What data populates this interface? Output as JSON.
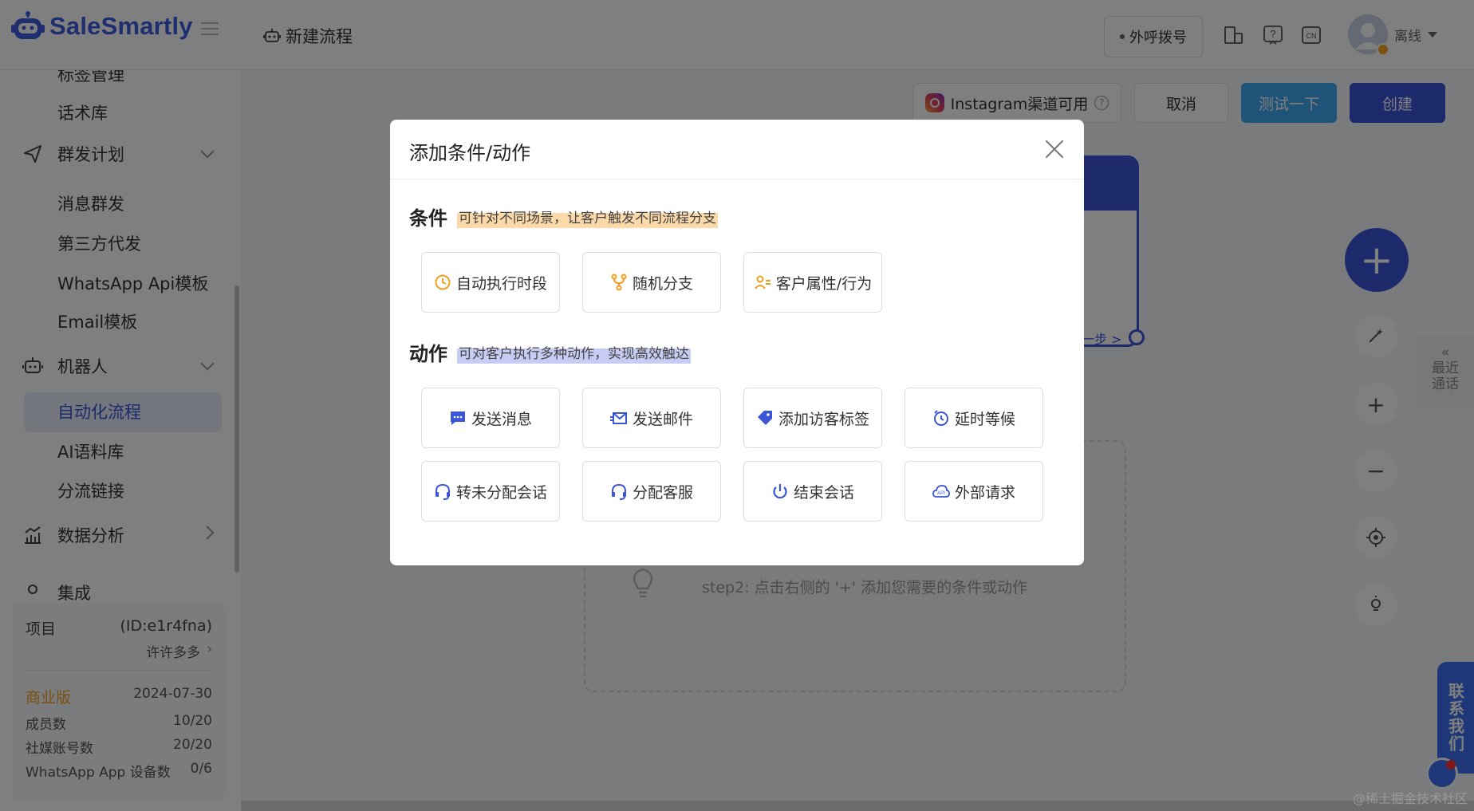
{
  "app": {
    "logo_text": "SaleSmartly",
    "brand_color": "#3b55d8"
  },
  "header": {
    "page_title": "新建流程",
    "dial_label": "外呼拨号",
    "user_status": "离线",
    "icons": [
      "device-icon",
      "help-icon",
      "language-cn-icon"
    ],
    "lang_badge": "CN"
  },
  "sidebar": {
    "cut_top_item": "标签管理",
    "items": [
      {
        "type": "item",
        "label": "话术库"
      },
      {
        "type": "group",
        "label": "群发计划",
        "icon": "send-icon"
      },
      {
        "type": "item",
        "label": "消息群发"
      },
      {
        "type": "item",
        "label": "第三方代发"
      },
      {
        "type": "item",
        "label": "WhatsApp Api模板"
      },
      {
        "type": "item",
        "label": "Email模板"
      },
      {
        "type": "group",
        "label": "机器人",
        "icon": "robot-icon"
      },
      {
        "type": "item",
        "label": "自动化流程",
        "active": true
      },
      {
        "type": "item",
        "label": "AI语料库"
      },
      {
        "type": "item",
        "label": "分流链接"
      },
      {
        "type": "group",
        "label": "数据分析",
        "icon": "chart-icon"
      },
      {
        "type": "group",
        "label": "集成",
        "icon": "integration-icon"
      }
    ],
    "project": {
      "label": "项目",
      "id": "(ID:e1r4fna)",
      "user": "许许多多",
      "plan": "商业版",
      "expiry": "2024-07-30",
      "stats": [
        {
          "label": "成员数",
          "value": "10/20"
        },
        {
          "label": "社媒账号数",
          "value": "20/20"
        },
        {
          "label": "WhatsApp App 设备数",
          "value": "0/6"
        }
      ]
    }
  },
  "toolbar": {
    "instagram_label": "Instagram渠道可用",
    "cancel_label": "取消",
    "test_label": "测试一下",
    "create_label": "创建"
  },
  "canvas": {
    "next_step_label": "一步 >",
    "step2_text": "step2: 点击右侧的 '+' 添加您需要的条件或动作",
    "recent_label": "最近通话",
    "contact_label": "联系我们",
    "watermark": "@稀土掘金技术社区"
  },
  "modal": {
    "title": "添加条件/动作",
    "conditions": {
      "title": "条件",
      "hint": "可针对不同场景，让客户触发不同流程分支",
      "options": [
        {
          "label": "自动执行时段",
          "icon": "clock-icon"
        },
        {
          "label": "随机分支",
          "icon": "branch-icon"
        },
        {
          "label": "客户属性/行为",
          "icon": "user-attribute-icon"
        }
      ]
    },
    "actions": {
      "title": "动作",
      "hint": "可对客户执行多种动作，实现高效触达",
      "options": [
        {
          "label": "发送消息",
          "icon": "message-icon"
        },
        {
          "label": "发送邮件",
          "icon": "email-icon"
        },
        {
          "label": "添加访客标签",
          "icon": "tag-icon"
        },
        {
          "label": "延时等候",
          "icon": "timer-icon"
        },
        {
          "label": "转未分配会话",
          "icon": "headset-icon"
        },
        {
          "label": "分配客服",
          "icon": "headset-icon"
        },
        {
          "label": "结束会话",
          "icon": "power-icon"
        },
        {
          "label": "外部请求",
          "icon": "api-cloud-icon"
        }
      ]
    },
    "colors": {
      "condition_icon": "#f0a020",
      "action_icon": "#3b55d8",
      "condition_highlight": "#fcd9a8",
      "action_highlight": "#c7ccf4"
    }
  }
}
